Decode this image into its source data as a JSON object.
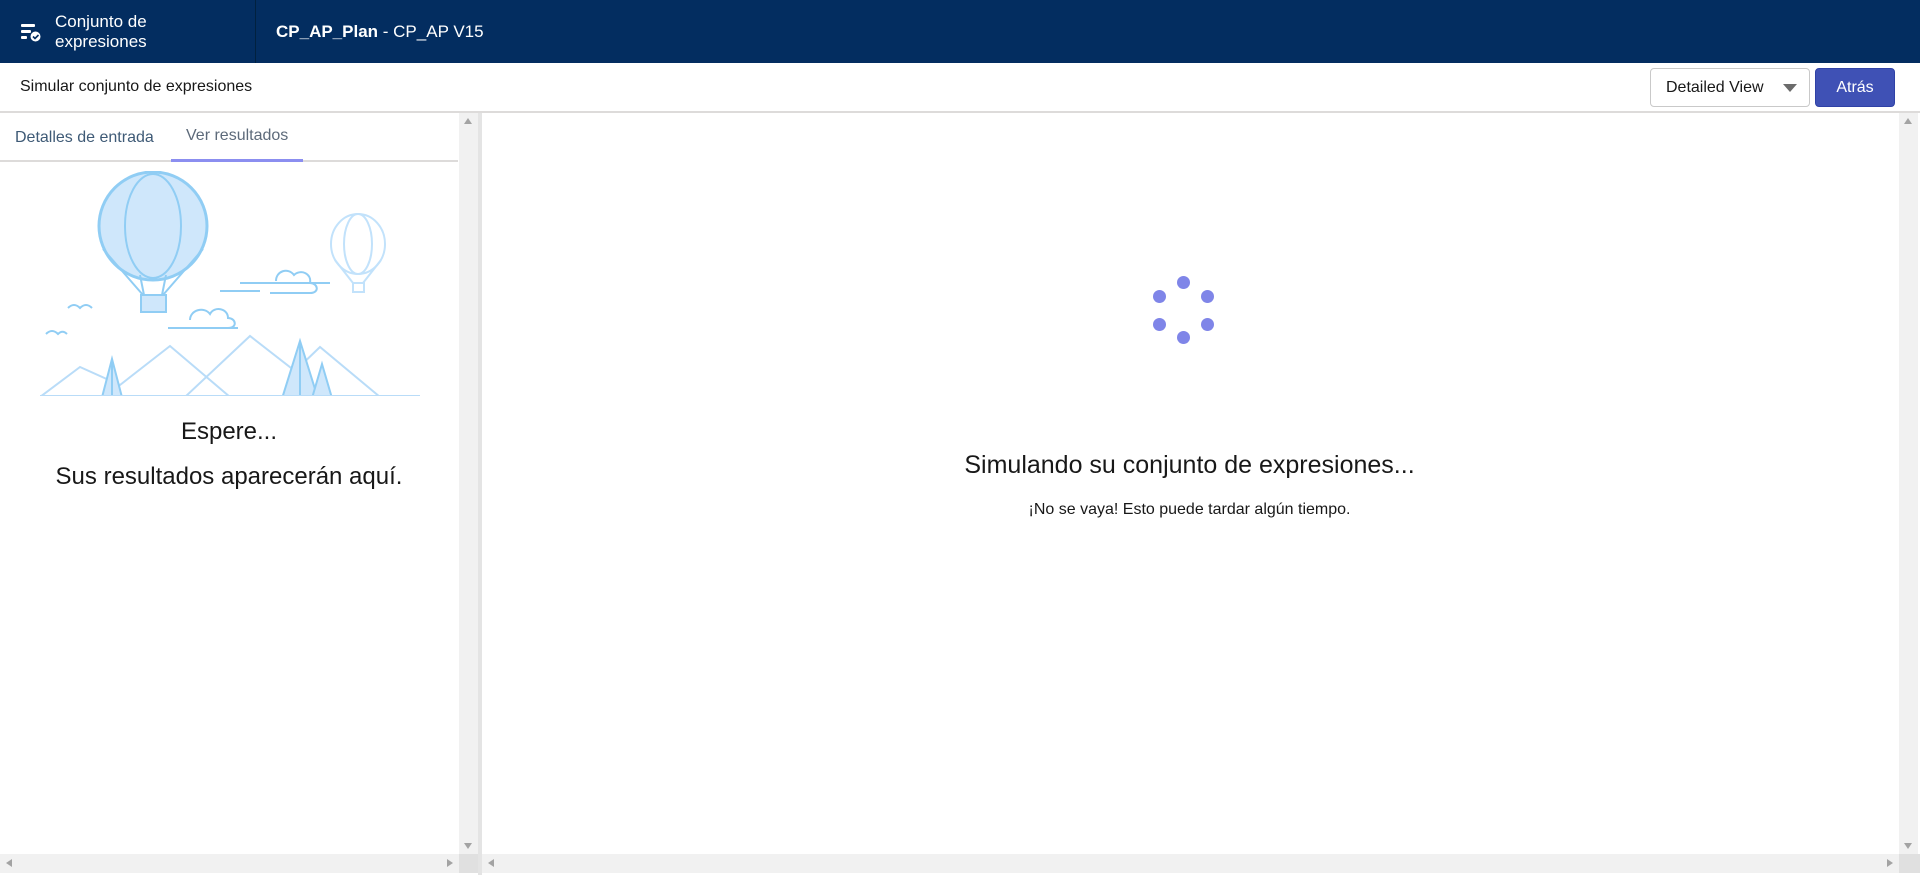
{
  "header": {
    "app_title": "Conjunto de expresiones",
    "record_name": "CP_AP_Plan",
    "record_suffix": " - CP_AP V15"
  },
  "subheader": {
    "title": "Simular conjunto de expresiones",
    "view_select_value": "Detailed View",
    "back_label": "Atrás"
  },
  "left_panel": {
    "tabs": [
      {
        "label": "Detalles de entrada",
        "active": false
      },
      {
        "label": "Ver resultados",
        "active": true
      }
    ],
    "wait_title": "Espere...",
    "wait_subtitle": "Sus resultados aparecerán aquí."
  },
  "right_panel": {
    "title": "Simulando su conjunto de expresiones...",
    "subtitle": "¡No se vaya! Esto puede tardar algún tiempo."
  },
  "colors": {
    "header_bg": "#032d60",
    "accent": "#3f51b5",
    "spinner": "#7f85e8",
    "illustration": "#90cdf4"
  }
}
